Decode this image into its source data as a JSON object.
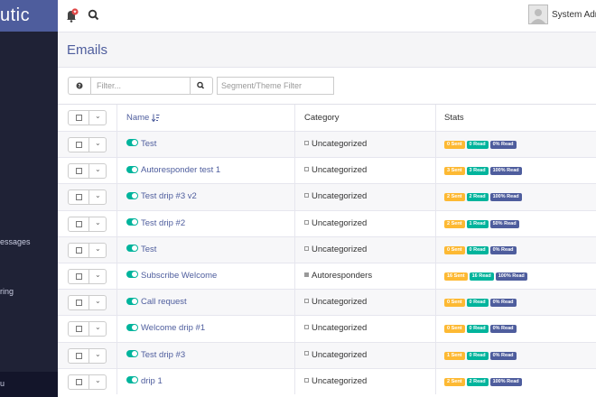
{
  "brand": {
    "text": "utic"
  },
  "sidebar": {
    "items": [
      {
        "label": "essages"
      },
      {
        "label": "ring"
      },
      {
        "label": "u"
      }
    ]
  },
  "topbar": {
    "user_name": "System Adm"
  },
  "page": {
    "title": "Emails"
  },
  "filters": {
    "filter_placeholder": "Filter...",
    "segment_placeholder": "Segment/Theme Filter"
  },
  "table": {
    "headers": {
      "name": "Name",
      "category": "Category",
      "stats": "Stats"
    },
    "rows": [
      {
        "name": "Test",
        "category": "Uncategorized",
        "category_filled": false,
        "sent": "0 Sent",
        "read": "0 Read",
        "pct": "0% Read"
      },
      {
        "name": "Autoresponder test 1",
        "category": "Uncategorized",
        "category_filled": false,
        "sent": "3 Sent",
        "read": "3 Read",
        "pct": "100% Read"
      },
      {
        "name": "Test drip #3 v2",
        "category": "Uncategorized",
        "category_filled": false,
        "sent": "2 Sent",
        "read": "2 Read",
        "pct": "100% Read"
      },
      {
        "name": "Test drip #2",
        "category": "Uncategorized",
        "category_filled": false,
        "sent": "2 Sent",
        "read": "1 Read",
        "pct": "50% Read"
      },
      {
        "name": "Test",
        "category": "Uncategorized",
        "category_filled": false,
        "sent": "0 Sent",
        "read": "0 Read",
        "pct": "0% Read"
      },
      {
        "name": "Subscribe Welcome",
        "category": "Autoresponders",
        "category_filled": true,
        "sent": "16 Sent",
        "read": "16 Read",
        "pct": "100% Read"
      },
      {
        "name": "Call request",
        "category": "Uncategorized",
        "category_filled": false,
        "sent": "0 Sent",
        "read": "0 Read",
        "pct": "0% Read"
      },
      {
        "name": "Welcome drip #1",
        "category": "Uncategorized",
        "category_filled": false,
        "sent": "0 Sent",
        "read": "0 Read",
        "pct": "0% Read"
      },
      {
        "name": "Test drip #3",
        "category": "Uncategorized",
        "category_filled": false,
        "sent": "1 Sent",
        "read": "0 Read",
        "pct": "0% Read"
      },
      {
        "name": "drip 1",
        "category": "Uncategorized",
        "category_filled": false,
        "sent": "2 Sent",
        "read": "2 Read",
        "pct": "100% Read"
      }
    ]
  },
  "colors": {
    "brand": "#4e5d9d",
    "sidebar_bg": "#1f2236",
    "badge_sent": "#fdb933",
    "badge_read": "#00b49c",
    "badge_pct": "#4e5d9d",
    "toggle_on": "#00b49c"
  },
  "icons": {
    "notification": "bell-icon",
    "search": "search-icon",
    "help": "question-icon",
    "sort": "sort-alpha-icon",
    "avatar": "user-avatar"
  }
}
